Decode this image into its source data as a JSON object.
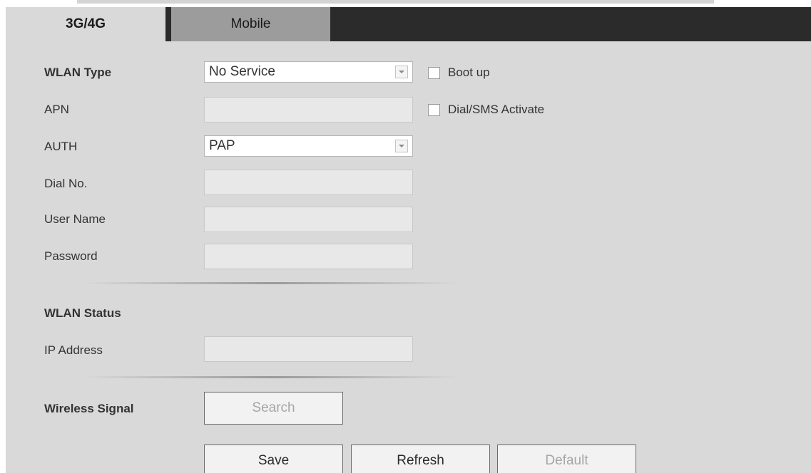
{
  "tabs": [
    {
      "label": "3G/4G",
      "active": true
    },
    {
      "label": "Mobile",
      "active": false
    }
  ],
  "form": {
    "wlan_type": {
      "label": "WLAN Type",
      "value": "No Service"
    },
    "apn": {
      "label": "APN",
      "value": ""
    },
    "auth": {
      "label": "AUTH",
      "value": "PAP"
    },
    "dial_no": {
      "label": "Dial No.",
      "value": ""
    },
    "user_name": {
      "label": "User Name",
      "value": ""
    },
    "password": {
      "label": "Password",
      "value": ""
    }
  },
  "checkboxes": {
    "boot_up": {
      "label": "Boot up",
      "checked": false
    },
    "dial_sms_activate": {
      "label": "Dial/SMS Activate",
      "checked": false
    }
  },
  "status": {
    "heading": "WLAN Status",
    "ip_address": {
      "label": "IP Address",
      "value": ""
    }
  },
  "wireless": {
    "label": "Wireless Signal",
    "search_button": "Search"
  },
  "actions": {
    "save": "Save",
    "refresh": "Refresh",
    "default": "Default"
  },
  "colors": {
    "panel_bg": "#d9d9d9",
    "tabbar_bg": "#2b2b2b",
    "inactive_tab_bg": "#9c9c9c",
    "disabled_text": "#a6a6a6"
  }
}
